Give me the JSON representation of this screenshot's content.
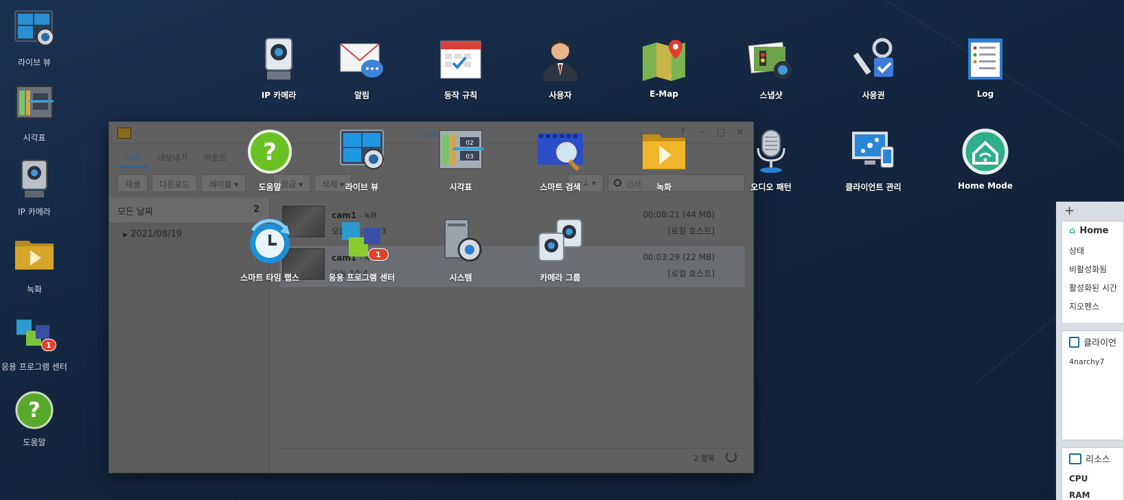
{
  "desktop_shortcuts": [
    {
      "label": "라이브 뷰",
      "icon": "live-view-icon"
    },
    {
      "label": "시각표",
      "icon": "timeline-icon"
    },
    {
      "label": "IP 카메라",
      "icon": "ip-camera-icon"
    },
    {
      "label": "녹화",
      "icon": "recording-icon"
    },
    {
      "label": "응용 프로그램 센터",
      "icon": "package-center-icon",
      "badge": "1"
    },
    {
      "label": "도움말",
      "icon": "help-icon"
    }
  ],
  "window": {
    "title": "녹화",
    "tabs": [
      "목록",
      "내보내기",
      "마운트",
      "고급"
    ],
    "toolbar": {
      "play": "재생",
      "download": "다운로드",
      "label": "레이블",
      "lock": "잠금",
      "delete": "삭제",
      "sort": "≡↓",
      "search_placeholder": "검색"
    },
    "tree": [
      {
        "label": "모든 날짜",
        "count": "2"
      },
      {
        "label": "2021/08/19",
        "count": "2"
      }
    ],
    "recordings": [
      {
        "camera": "cam1",
        "type": "- 녹화",
        "time": "오늘 10:44:33",
        "duration": "00:08:21 (44 MB)",
        "host": "[로컬 호스트]"
      },
      {
        "camera": "cam1",
        "type": "- 녹화",
        "time": "오늘 10:4",
        "duration": "00:03:29 (22 MB)",
        "host": "[로컬 호스트]"
      }
    ],
    "status_count": "2 항목"
  },
  "launcher": [
    {
      "label": "IP 카메라",
      "icon": "ip-camera-icon"
    },
    {
      "label": "알림",
      "icon": "notification-icon"
    },
    {
      "label": "동작 규칙",
      "icon": "action-rule-icon"
    },
    {
      "label": "사용자",
      "icon": "user-icon"
    },
    {
      "label": "E-Map",
      "icon": "emap-icon"
    },
    {
      "label": "스냅샷",
      "icon": "snapshot-icon"
    },
    {
      "label": "사용권",
      "icon": "license-icon"
    },
    {
      "label": "Log",
      "icon": "log-icon"
    },
    {
      "label": "도움말",
      "icon": "help-icon"
    },
    {
      "label": "라이브 뷰",
      "icon": "live-view-icon"
    },
    {
      "label": "시각표",
      "icon": "timeline-icon"
    },
    {
      "label": "스마트 검색",
      "icon": "smart-search-icon"
    },
    {
      "label": "녹화",
      "icon": "recording-icon"
    },
    {
      "label": "오디오 패턴",
      "icon": "audio-pattern-icon"
    },
    {
      "label": "클라이언트 관리",
      "icon": "client-management-icon"
    },
    {
      "label": "Home Mode",
      "icon": "home-mode-icon"
    },
    {
      "label": "스마트 타임 랩스",
      "icon": "time-lapse-icon"
    },
    {
      "label": "응용 프로그램 센터",
      "icon": "package-center-icon",
      "badge": "1"
    },
    {
      "label": "시스템",
      "icon": "system-icon"
    },
    {
      "label": "카메라 그룹",
      "icon": "camera-group-icon"
    }
  ],
  "widgets": {
    "add": "+",
    "home": {
      "title": "Home",
      "rows": [
        "상태",
        "비활성화됨",
        "활성화된 시간",
        "지오펜스"
      ]
    },
    "client": {
      "title": "클라이언",
      "rows": [
        "4narchy7"
      ]
    },
    "resource": {
      "title": "리소스 ",
      "rows": [
        "CPU",
        "RAM"
      ]
    }
  },
  "colors": {
    "accent": "#2f5f8a",
    "badge": "#e0412b",
    "background": "#14263f"
  }
}
